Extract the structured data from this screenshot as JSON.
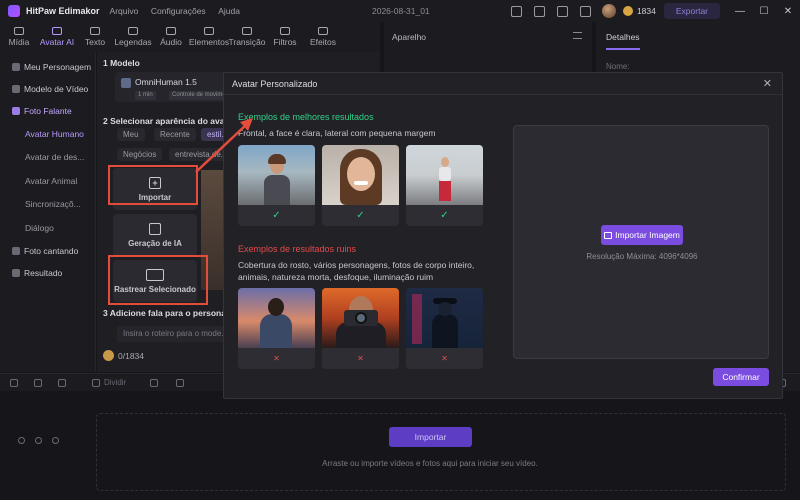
{
  "app": {
    "name": "HitPaw Edimakor",
    "menu": [
      "Arquivo",
      "Configurações",
      "Ajuda"
    ],
    "doc_title": "2026-08-31_01",
    "credits": "1834",
    "export_label": "Exportar",
    "window_controls": [
      "—",
      "☐",
      "✕"
    ]
  },
  "toolbar": {
    "tools": [
      {
        "label": "Mídia",
        "icon": "media-icon"
      },
      {
        "label": "Avatar AI",
        "icon": "avatar-ai-icon",
        "active": true
      },
      {
        "label": "Texto",
        "icon": "text-icon"
      },
      {
        "label": "Legendas",
        "icon": "subtitles-icon"
      },
      {
        "label": "Áudio",
        "icon": "audio-icon"
      },
      {
        "label": "Elementos",
        "icon": "elements-icon"
      },
      {
        "label": "Transição",
        "icon": "transition-icon"
      },
      {
        "label": "Filtros",
        "icon": "filters-icon"
      },
      {
        "label": "Efeitos",
        "icon": "effects-icon"
      }
    ]
  },
  "sidebar": {
    "items": [
      {
        "label": "Meu Personagem"
      },
      {
        "label": "Modelo de Vídeo"
      },
      {
        "label": "Foto Falante",
        "selected": true
      }
    ],
    "subitems": [
      {
        "label": "Avatar Humano",
        "active": true
      },
      {
        "label": "Avatar de des..."
      },
      {
        "label": "Avatar Animal"
      },
      {
        "label": "Sincronizaçõ..."
      },
      {
        "label": "Diálogo"
      }
    ],
    "bottom_items": [
      {
        "label": "Foto cantando"
      },
      {
        "label": "Resultado"
      }
    ]
  },
  "panel": {
    "step1": "1 Modelo",
    "model_name": "OmniHuman 1.5",
    "model_tags": [
      "1 min",
      "Controle de movimen..."
    ],
    "step2": "2 Selecionar aparência do avat...",
    "chips_row1": [
      "Meu",
      "Recente",
      "estil..."
    ],
    "chips_row2": [
      "Negócios",
      "entrevista de..."
    ],
    "import_label": "Importar",
    "ai_gen_label": "Geração de IA",
    "track_label": "Rastrear Selecionado",
    "step3": "3 Adicione fala para o persona...",
    "script_placeholder": "Insira o roteiro para o mode...",
    "credit_count": "0/1834"
  },
  "player": {
    "title": "Aparelho"
  },
  "details": {
    "tab": "Detalhes",
    "label": "Nome:"
  },
  "timeline": {
    "split_label": "Dividir",
    "import_label": "Importar",
    "hint": "Arraste ou importe vídeos e fotos aqui para iniciar seu vídeo."
  },
  "modal": {
    "title": "Avatar Personalizado",
    "close": "✕",
    "good_title": "Exemplos de melhores resultados",
    "good_desc": "Frontal, a face é clara, lateral com pequena margem",
    "bad_title": "Exemplos de resultados ruins",
    "bad_desc": "Cobertura do rosto, vários personagens, fotos de corpo inteiro, animais, natureza morta, desfoque, iluminação ruim",
    "good_mark": "✓",
    "bad_mark": "✕",
    "import_label": "Importar Imagem",
    "resolution": "Resolução Máxima: 4096*4096",
    "confirm_label": "Confirmar"
  },
  "colors": {
    "accent": "#7a4de0",
    "good": "#34d089",
    "bad": "#e74a4a",
    "highlight": "#e44c3c"
  }
}
